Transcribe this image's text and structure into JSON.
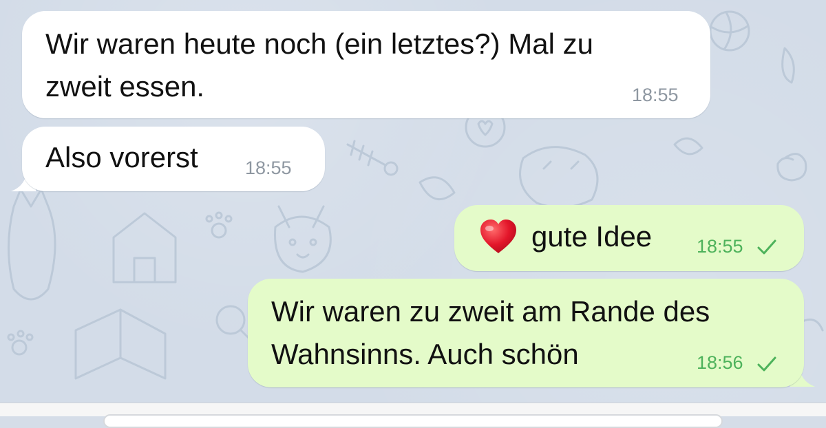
{
  "colors": {
    "incoming_bubble": "#ffffff",
    "outgoing_bubble": "#e4fbc9",
    "outgoing_time": "#4db25b",
    "incoming_time": "#8e97a1",
    "wallpaper": "#d3dce8"
  },
  "messages": [
    {
      "direction": "incoming",
      "lines": [
        "Wir waren heute noch (ein letztes?) Mal zu",
        "zweit essen."
      ],
      "time": "18:55"
    },
    {
      "direction": "incoming",
      "lines": [
        "Also vorerst"
      ],
      "time": "18:55"
    },
    {
      "direction": "outgoing",
      "emoji": "heart",
      "lines": [
        "gute Idee"
      ],
      "time": "18:55",
      "status_icon": "check-icon"
    },
    {
      "direction": "outgoing",
      "lines": [
        "Wir waren zu zweit am Rande des",
        "Wahnsinns. Auch schön"
      ],
      "time": "18:56",
      "status_icon": "check-icon"
    }
  ]
}
